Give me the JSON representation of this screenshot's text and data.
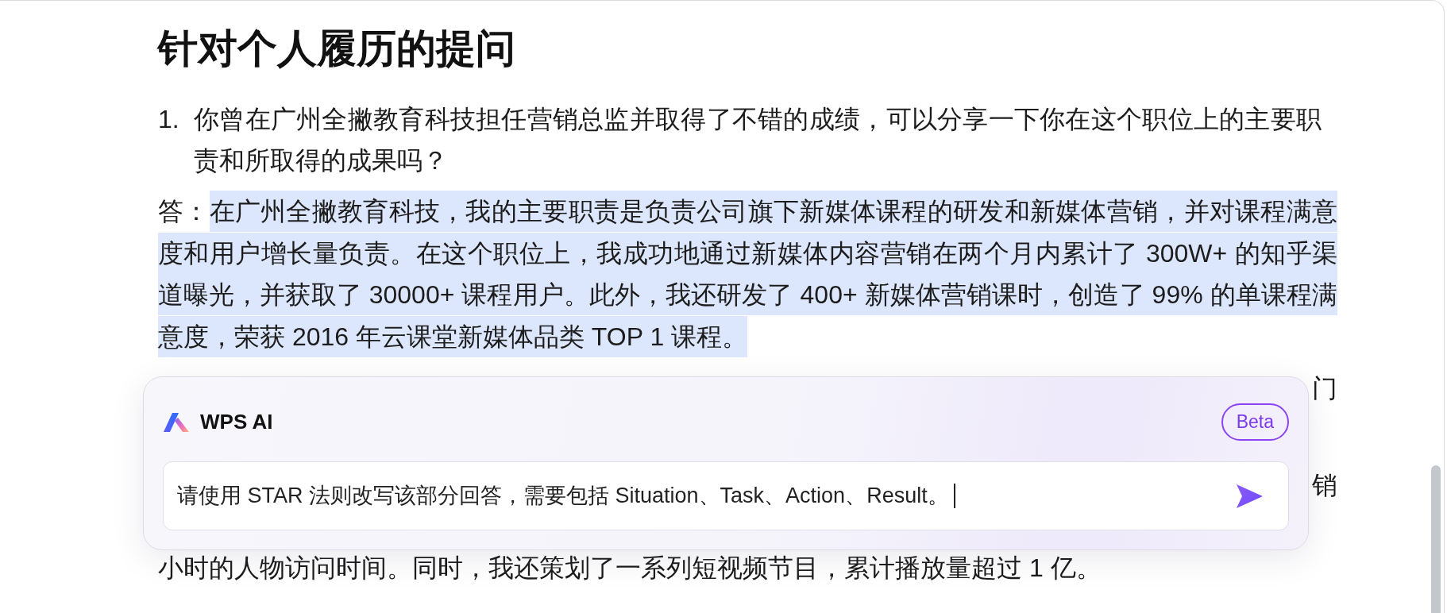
{
  "document": {
    "heading": "针对个人履历的提问",
    "questions": [
      {
        "number": "1.",
        "text": "你曾在广州全撇教育科技担任营销总监并取得了不错的成绩，可以分享一下你在这个职位上的主要职责和所取得的成果吗？",
        "answer": {
          "label": "答：",
          "text": "在广州全撇教育科技，我的主要职责是负责公司旗下新媒体课程的研发和新媒体营销，并对课程满意度和用户增长量负责。在这个职位上，我成功地通过新媒体内容营销在两个月内累计了 300W+ 的知乎渠道曝光，并获取了 30000+ 课程用户。此外，我还研发了 400+ 新媒体营销课时，创造了 99% 的单课程满意度，荣获 2016 年云课堂新媒体品类 TOP 1 课程。",
          "selected": true
        }
      }
    ],
    "partly_covered": {
      "question_line_end": "门",
      "answer_line_end": "销",
      "last_line": "小时的人物访问时间。同时，我还策划了一系列短视频节目，累计播放量超过 1 亿。"
    }
  },
  "ai_panel": {
    "title": "WPS AI",
    "badge": "Beta",
    "prompt": {
      "value": "请使用 STAR 法则改写该部分回答，需要包括 Situation、Task、Action、Result。",
      "focused": true
    }
  }
}
